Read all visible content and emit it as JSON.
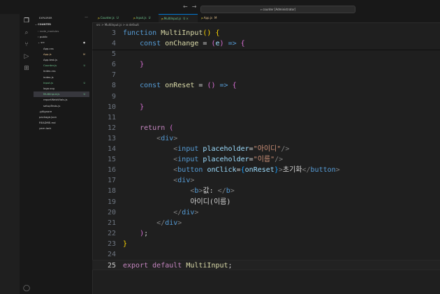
{
  "titlebar": {
    "nav_back": "←",
    "nav_forward": "→",
    "search_text": "counter [Administrator]"
  },
  "activity_bar": {
    "icons": [
      "explorer-icon",
      "search-icon",
      "source-control-icon",
      "run-debug-icon",
      "extensions-icon",
      "account-icon"
    ]
  },
  "explorer": {
    "title": "EXPLORER",
    "more": "···",
    "folder": "COUNTER",
    "items": [
      {
        "label": "node_modules",
        "prefix": "›",
        "badge": "",
        "color": "#8b8b8b",
        "selected": false
      },
      {
        "label": "public",
        "prefix": "›",
        "badge": "",
        "color": "#cccccc",
        "selected": false
      },
      {
        "label": "src",
        "prefix": "⌄",
        "badge": "●",
        "color": "#cccccc",
        "selected": false
      },
      {
        "label": "App.css",
        "prefix": "",
        "badge": "",
        "color": "#cccccc",
        "selected": false
      },
      {
        "label": "App.js",
        "prefix": "",
        "badge": "M",
        "color": "#e2c08d",
        "selected": false
      },
      {
        "label": "App.test.js",
        "prefix": "",
        "badge": "",
        "color": "#cccccc",
        "selected": false
      },
      {
        "label": "Counter.js",
        "prefix": "",
        "badge": "U",
        "color": "#73c991",
        "selected": false
      },
      {
        "label": "index.css",
        "prefix": "",
        "badge": "",
        "color": "#cccccc",
        "selected": false
      },
      {
        "label": "index.js",
        "prefix": "",
        "badge": "",
        "color": "#cccccc",
        "selected": false
      },
      {
        "label": "Input.js",
        "prefix": "",
        "badge": "U",
        "color": "#73c991",
        "selected": false
      },
      {
        "label": "logo.svg",
        "prefix": "",
        "badge": "",
        "color": "#cccccc",
        "selected": false
      },
      {
        "label": "MultiInput.js",
        "prefix": "",
        "badge": "U",
        "color": "#73c991",
        "selected": true
      },
      {
        "label": "reportWebVitals.js",
        "prefix": "",
        "badge": "",
        "color": "#cccccc",
        "selected": false
      },
      {
        "label": "setupTests.js",
        "prefix": "",
        "badge": "",
        "color": "#cccccc",
        "selected": false
      },
      {
        "label": ".gitignore",
        "prefix": "",
        "badge": "",
        "color": "#cccccc",
        "selected": false
      },
      {
        "label": "package.json",
        "prefix": "",
        "badge": "",
        "color": "#cccccc",
        "selected": false
      },
      {
        "label": "README.md",
        "prefix": "",
        "badge": "",
        "color": "#cccccc",
        "selected": false
      },
      {
        "label": "yarn.lock",
        "prefix": "",
        "badge": "",
        "color": "#cccccc",
        "selected": false
      }
    ]
  },
  "tabs": [
    {
      "label": "Counter.js",
      "badge": "U",
      "color": "#73c991",
      "active": false
    },
    {
      "label": "Input.js",
      "badge": "U",
      "color": "#73c991",
      "active": false
    },
    {
      "label": "MultiInput.js",
      "badge": "U ×",
      "color": "#73c991",
      "active": true
    },
    {
      "label": "App.js",
      "badge": "M",
      "color": "#e2c08d",
      "active": false
    }
  ],
  "breadcrumb": "src > MultiInput.js > ⊞ default",
  "editor": {
    "lines": [
      {
        "num": "3",
        "parts": [
          [
            "kw",
            "function "
          ],
          [
            "fn",
            "MultiInput"
          ],
          [
            "br1",
            "()"
          ],
          [
            "pl",
            " "
          ],
          [
            "br1",
            "{"
          ]
        ]
      },
      {
        "num": "4",
        "parts": [
          [
            "pl",
            "    "
          ],
          [
            "kw",
            "const "
          ],
          [
            "fn",
            "onChange"
          ],
          [
            "pl",
            " = "
          ],
          [
            "br2",
            "("
          ],
          [
            "var",
            "e"
          ],
          [
            "br2",
            ")"
          ],
          [
            "kw",
            " => "
          ],
          [
            "br2",
            "{"
          ]
        ]
      },
      {
        "num": "5",
        "parts": []
      },
      {
        "num": "6",
        "parts": [
          [
            "pl",
            "    "
          ],
          [
            "br2",
            "}"
          ]
        ]
      },
      {
        "num": "7",
        "parts": []
      },
      {
        "num": "8",
        "parts": [
          [
            "pl",
            "    "
          ],
          [
            "kw",
            "const "
          ],
          [
            "fn",
            "onReset"
          ],
          [
            "pl",
            " = "
          ],
          [
            "br2",
            "()"
          ],
          [
            "kw",
            " => "
          ],
          [
            "br2",
            "{"
          ]
        ]
      },
      {
        "num": "9",
        "parts": []
      },
      {
        "num": "10",
        "parts": [
          [
            "pl",
            "    "
          ],
          [
            "br2",
            "}"
          ]
        ]
      },
      {
        "num": "11",
        "parts": []
      },
      {
        "num": "12",
        "parts": [
          [
            "pl",
            "    "
          ],
          [
            "ctl",
            "return "
          ],
          [
            "br2",
            "("
          ]
        ]
      },
      {
        "num": "13",
        "parts": [
          [
            "pl",
            "        "
          ],
          [
            "gray",
            "<"
          ],
          [
            "tag",
            "div"
          ],
          [
            "gray",
            ">"
          ]
        ]
      },
      {
        "num": "14",
        "parts": [
          [
            "pl",
            "            "
          ],
          [
            "gray",
            "<"
          ],
          [
            "tag",
            "input"
          ],
          [
            "pl",
            " "
          ],
          [
            "var",
            "placeholder"
          ],
          [
            "pl",
            "="
          ],
          [
            "str",
            "\"아이디\""
          ],
          [
            "gray",
            "/>"
          ]
        ]
      },
      {
        "num": "15",
        "parts": [
          [
            "pl",
            "            "
          ],
          [
            "gray",
            "<"
          ],
          [
            "tag",
            "input"
          ],
          [
            "pl",
            " "
          ],
          [
            "var",
            "placeholder"
          ],
          [
            "pl",
            "="
          ],
          [
            "str",
            "\"이름\""
          ],
          [
            "gray",
            "/>"
          ]
        ]
      },
      {
        "num": "16",
        "parts": [
          [
            "pl",
            "            "
          ],
          [
            "gray",
            "<"
          ],
          [
            "tag",
            "button"
          ],
          [
            "pl",
            " "
          ],
          [
            "var",
            "onClick"
          ],
          [
            "pl",
            "="
          ],
          [
            "br3",
            "{"
          ],
          [
            "var",
            "onReset"
          ],
          [
            "br3",
            "}"
          ],
          [
            "gray",
            ">"
          ],
          [
            "pl",
            "초기화"
          ],
          [
            "gray",
            "</"
          ],
          [
            "tag",
            "button"
          ],
          [
            "gray",
            ">"
          ]
        ]
      },
      {
        "num": "17",
        "parts": [
          [
            "pl",
            "            "
          ],
          [
            "gray",
            "<"
          ],
          [
            "tag",
            "div"
          ],
          [
            "gray",
            ">"
          ]
        ]
      },
      {
        "num": "18",
        "parts": [
          [
            "pl",
            "                "
          ],
          [
            "gray",
            "<"
          ],
          [
            "tag",
            "b"
          ],
          [
            "gray",
            ">"
          ],
          [
            "pl",
            "값: "
          ],
          [
            "gray",
            "</"
          ],
          [
            "tag",
            "b"
          ],
          [
            "gray",
            ">"
          ]
        ]
      },
      {
        "num": "19",
        "parts": [
          [
            "pl",
            "                아이디(이름)"
          ]
        ]
      },
      {
        "num": "20",
        "parts": [
          [
            "pl",
            "            "
          ],
          [
            "gray",
            "</"
          ],
          [
            "tag",
            "div"
          ],
          [
            "gray",
            ">"
          ]
        ]
      },
      {
        "num": "21",
        "parts": [
          [
            "pl",
            "        "
          ],
          [
            "gray",
            "</"
          ],
          [
            "tag",
            "div"
          ],
          [
            "gray",
            ">"
          ]
        ]
      },
      {
        "num": "22",
        "parts": [
          [
            "pl",
            "    "
          ],
          [
            "br2",
            ")"
          ],
          [
            "pl",
            ";"
          ]
        ]
      },
      {
        "num": "23",
        "parts": [
          [
            "br1",
            "}"
          ]
        ]
      },
      {
        "num": "24",
        "parts": []
      },
      {
        "num": "25",
        "parts": [
          [
            "ctl",
            "export "
          ],
          [
            "ctl",
            "default "
          ],
          [
            "fn",
            "MultiInput"
          ],
          [
            "pl",
            ";"
          ]
        ],
        "active": true
      }
    ]
  }
}
